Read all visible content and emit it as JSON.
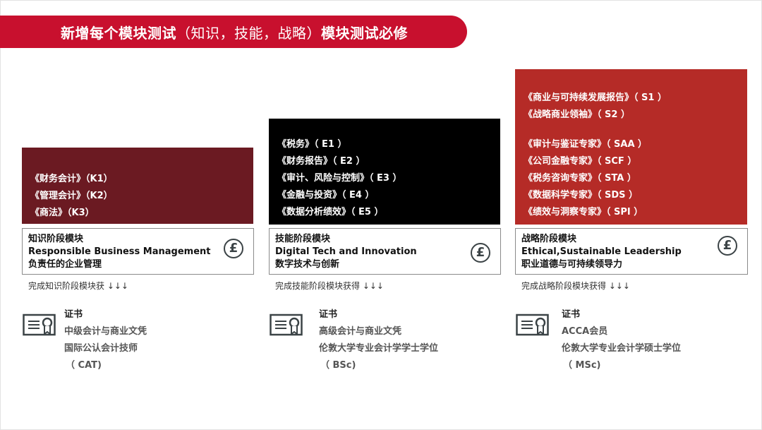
{
  "banner": {
    "prefix": "新增每个模块测试",
    "middle": "（知识，技能，战略）",
    "suffix": "模块测试必修"
  },
  "columns": [
    {
      "box_items": [
        "《财务会计》（K1）",
        "《管理会计》（K2）",
        "《商法》（K3）"
      ],
      "box_color": "#6b1a22",
      "stage_lines": [
        "知识阶段模块",
        "Responsible Business Management",
        "负责任的企业管理"
      ],
      "complete_text": "完成知识阶段模块获 ↓↓↓",
      "cert_title": "证书",
      "cert_lines": [
        "中级会计与商业文凭",
        "国际公认会计技师",
        "（ CAT)"
      ]
    },
    {
      "box_items": [
        "《税务》（ E1 ）",
        "《财务报告》（ E2 ）",
        "《审计、风险与控制》（ E3 ）",
        "《金融与投资》（ E4 ）",
        "《数据分析绩效》（ E5 ）"
      ],
      "box_color": "#000000",
      "stage_lines": [
        "技能阶段模块",
        "Digital Tech and Innovation",
        "数字技术与创新"
      ],
      "complete_text": "完成技能阶段模块获得 ↓↓↓",
      "cert_title": "证书",
      "cert_lines": [
        "高级会计与商业文凭",
        "伦敦大学专业会计学学士学位",
        "（ BSc)"
      ]
    },
    {
      "box_items_top": [
        "《商业与可持续发展报告》（ S1 ）",
        "《战略商业领袖》（ S2 ）"
      ],
      "box_items": [
        "《审计与鉴证专家》（ SAA ）",
        "《公司金融专家》（ SCF ）",
        "《税务咨询专家》（ STA ）",
        "《数据科学专家》（ SDS ）",
        "《绩效与洞察专家》（ SPI ）"
      ],
      "box_color": "#b52b27",
      "stage_lines": [
        "战略阶段模块",
        "Ethical,Sustainable Leadership",
        "职业道德与可持续领导力"
      ],
      "complete_text": "完成战略阶段模块获得 ↓↓↓",
      "cert_title": "证书",
      "cert_lines": [
        "ACCA会员",
        "伦敦大学专业会计学硕士学位",
        "（ MSc)"
      ]
    }
  ],
  "icons": {
    "currency": "pound-icon",
    "certificate": "certificate-icon",
    "pound_glyph": "£"
  },
  "colors": {
    "banner": "#c8102e"
  }
}
